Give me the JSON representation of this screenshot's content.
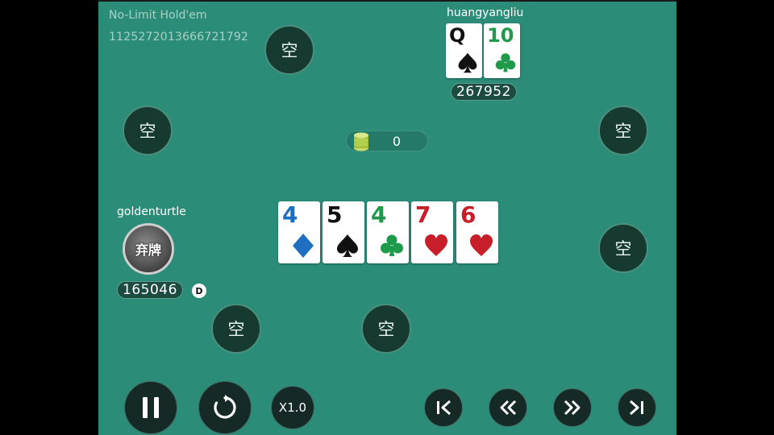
{
  "table": {
    "game_title": "No-Limit Hold'em",
    "hand_id": "1125272013666721792",
    "empty_seat_label": "空",
    "felt_color": "#2b8c78"
  },
  "opponent": {
    "name": "huangyangliu",
    "chips": "267952",
    "cards": [
      {
        "rank": "Q",
        "suit": "spade",
        "color": "#111111"
      },
      {
        "rank": "10",
        "suit": "club",
        "color": "#1f9a4a"
      }
    ]
  },
  "hero": {
    "name": "goldenturtle",
    "chips": "165046",
    "status": "弃牌",
    "dealer_badge": "D"
  },
  "pot": {
    "value": "0",
    "icon": "chip-stack-icon"
  },
  "board": [
    {
      "rank": "4",
      "suit": "diamond",
      "color": "#1e6fc2"
    },
    {
      "rank": "5",
      "suit": "spade",
      "color": "#111111"
    },
    {
      "rank": "4",
      "suit": "club",
      "color": "#1f9a4a"
    },
    {
      "rank": "7",
      "suit": "heart",
      "color": "#c81e2a"
    },
    {
      "rank": "6",
      "suit": "heart",
      "color": "#c81e2a"
    }
  ],
  "controls": {
    "pause_icon": "pause-icon",
    "replay_icon": "replay-icon",
    "speed_label": "X1.0",
    "first_icon": "skip-to-start-icon",
    "prev_icon": "rewind-icon",
    "next_icon": "fast-forward-icon",
    "last_icon": "skip-to-end-icon"
  }
}
